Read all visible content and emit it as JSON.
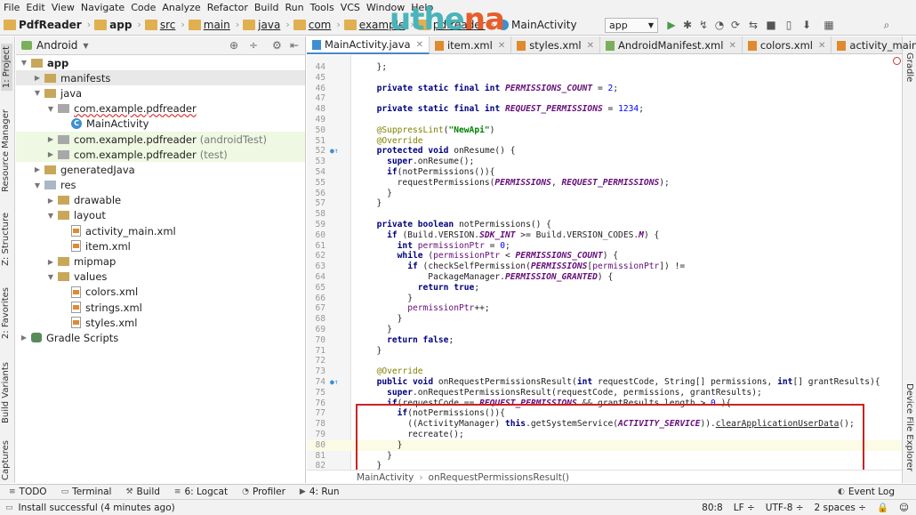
{
  "menu": [
    "File",
    "Edit",
    "View",
    "Navigate",
    "Code",
    "Analyze",
    "Refactor",
    "Build",
    "Run",
    "Tools",
    "VCS",
    "Window",
    "Help"
  ],
  "breadcrumbs": [
    "PdfReader",
    "app",
    "src",
    "main",
    "java",
    "com",
    "example",
    "pdfreader",
    "MainActivity"
  ],
  "watermark": {
    "part1": "uthe",
    "part2": "na"
  },
  "run_config": "app",
  "side_tabs_left": [
    "1: Project",
    "Resource Manager",
    "Z: Structure",
    "2: Favorites",
    "Build Variants",
    "Captures"
  ],
  "side_tabs_right": [
    "Gradle",
    "Device File Explorer"
  ],
  "project_view": "Android",
  "tree": [
    {
      "label": "app",
      "depth": 0,
      "icon": "folder",
      "open": true,
      "style": "bold"
    },
    {
      "label": "manifests",
      "depth": 1,
      "icon": "folder",
      "open": false,
      "style": "hl"
    },
    {
      "label": "java",
      "depth": 1,
      "icon": "folder",
      "open": true
    },
    {
      "label": "com.example.pdfreader",
      "depth": 2,
      "icon": "package",
      "open": true,
      "style": "u"
    },
    {
      "label": "MainActivity",
      "depth": 3,
      "icon": "class",
      "open": null
    },
    {
      "label": "com.example.pdfreader",
      "suffix": "(androidTest)",
      "depth": 2,
      "icon": "package",
      "open": false,
      "style": "green"
    },
    {
      "label": "com.example.pdfreader",
      "suffix": "(test)",
      "depth": 2,
      "icon": "package",
      "open": false,
      "style": "green"
    },
    {
      "label": "generatedJava",
      "depth": 1,
      "icon": "folder",
      "open": false
    },
    {
      "label": "res",
      "depth": 1,
      "icon": "res",
      "open": true
    },
    {
      "label": "drawable",
      "depth": 2,
      "icon": "folder",
      "open": false
    },
    {
      "label": "layout",
      "depth": 2,
      "icon": "folder",
      "open": true
    },
    {
      "label": "activity_main.xml",
      "depth": 3,
      "icon": "xml",
      "open": null
    },
    {
      "label": "item.xml",
      "depth": 3,
      "icon": "xml",
      "open": null
    },
    {
      "label": "mipmap",
      "depth": 2,
      "icon": "folder",
      "open": false
    },
    {
      "label": "values",
      "depth": 2,
      "icon": "folder",
      "open": true
    },
    {
      "label": "colors.xml",
      "depth": 3,
      "icon": "xml",
      "open": null
    },
    {
      "label": "strings.xml",
      "depth": 3,
      "icon": "xml",
      "open": null
    },
    {
      "label": "styles.xml",
      "depth": 3,
      "icon": "xml",
      "open": null
    },
    {
      "label": "Gradle Scripts",
      "depth": 0,
      "icon": "gradle",
      "open": false
    }
  ],
  "tabs": [
    "MainActivity.java",
    "item.xml",
    "styles.xml",
    "AndroidManifest.xml",
    "colors.xml",
    "activity_main.xml"
  ],
  "code": [
    {
      "n": "44",
      "t": "  };"
    },
    {
      "n": "45",
      "t": ""
    },
    {
      "n": "46",
      "t": "  private static final int PERMISSIONS_COUNT = 2;"
    },
    {
      "n": "47",
      "t": ""
    },
    {
      "n": "48",
      "t": "  private static final int REQUEST_PERMISSIONS = 1234;"
    },
    {
      "n": "49",
      "t": ""
    },
    {
      "n": "50",
      "t": "  @SuppressLint(\"NewApi\")"
    },
    {
      "n": "51",
      "t": "  @Override"
    },
    {
      "n": "52",
      "t": "  protected void onResume() {"
    },
    {
      "n": "53",
      "t": "    super.onResume();"
    },
    {
      "n": "54",
      "t": "    if(notPermissions()){"
    },
    {
      "n": "55",
      "t": "      requestPermissions(PERMISSIONS, REQUEST_PERMISSIONS);"
    },
    {
      "n": "56",
      "t": "    }"
    },
    {
      "n": "57",
      "t": "  }"
    },
    {
      "n": "58",
      "t": ""
    },
    {
      "n": "59",
      "t": "  private boolean notPermissions() {"
    },
    {
      "n": "60",
      "t": "    if (Build.VERSION.SDK_INT >= Build.VERSION_CODES.M) {"
    },
    {
      "n": "61",
      "t": "      int permissionPtr = 0;"
    },
    {
      "n": "62",
      "t": "      while (permissionPtr < PERMISSIONS_COUNT) {"
    },
    {
      "n": "63",
      "t": "        if (checkSelfPermission(PERMISSIONS[permissionPtr]) !="
    },
    {
      "n": "64",
      "t": "            PackageManager.PERMISSION_GRANTED) {"
    },
    {
      "n": "65",
      "t": "          return true;"
    },
    {
      "n": "66",
      "t": "        }"
    },
    {
      "n": "67",
      "t": "        permissionPtr++;"
    },
    {
      "n": "68",
      "t": "      }"
    },
    {
      "n": "69",
      "t": "    }"
    },
    {
      "n": "70",
      "t": "    return false;"
    },
    {
      "n": "71",
      "t": "  }"
    },
    {
      "n": "72",
      "t": ""
    },
    {
      "n": "73",
      "t": "  @Override"
    },
    {
      "n": "74",
      "t": "  public void onRequestPermissionsResult(int requestCode, String[] permissions, int[] grantResults){"
    },
    {
      "n": "75",
      "t": "    super.onRequestPermissionsResult(requestCode, permissions, grantResults);"
    },
    {
      "n": "76",
      "t": "    if(requestCode == REQUEST_PERMISSIONS && grantResults.length > 0 ){"
    },
    {
      "n": "77",
      "t": "      if(notPermissions()){"
    },
    {
      "n": "78",
      "t": "        ((ActivityManager) this.getSystemService(ACTIVITY_SERVICE)).clearApplicationUserData();"
    },
    {
      "n": "79",
      "t": "        recreate();"
    },
    {
      "n": "80",
      "t": "      }"
    },
    {
      "n": "81",
      "t": "    }"
    },
    {
      "n": "82",
      "t": "  }"
    }
  ],
  "editor_breadcrumb": [
    "MainActivity",
    "onRequestPermissionsResult()"
  ],
  "bottom_tools": [
    {
      "icon": "≡",
      "label": "TODO"
    },
    {
      "icon": "▭",
      "label": "Terminal"
    },
    {
      "icon": "⚒",
      "label": "Build"
    },
    {
      "icon": "≡",
      "label": "6: Logcat"
    },
    {
      "icon": "◔",
      "label": "Profiler"
    },
    {
      "icon": "▶",
      "label": "4: Run"
    }
  ],
  "event_log": "Event Log",
  "status_message": "Install successful (4 minutes ago)",
  "status_right": [
    "80:8",
    "LF ÷",
    "UTF-8 ÷",
    "2 spaces ÷"
  ]
}
